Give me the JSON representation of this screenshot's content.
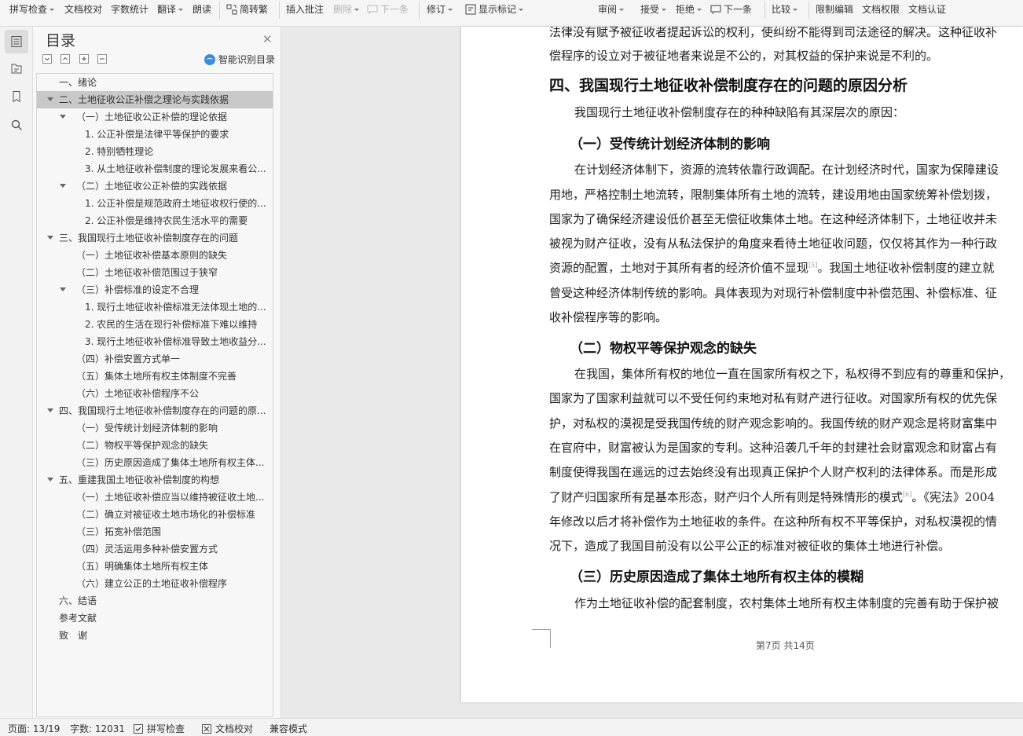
{
  "toolbar": {
    "spell_check": "拼写检查",
    "doc_proof": "文档校对",
    "word_count": "字数统计",
    "translate": "翻译",
    "read_aloud": "朗读",
    "simp_trad": "简转繁",
    "insert_comment": "插入批注",
    "delete": "删除",
    "next": "下一条",
    "track_changes": "修订",
    "show_markup": "显示标记",
    "review": "审阅",
    "accept": "接受",
    "reject": "拒绝",
    "next2": "下一条",
    "compare": "比较",
    "restrict_edit": "限制编辑",
    "doc_rights": "文档权限",
    "doc_cert": "文档认证"
  },
  "toc": {
    "title": "目录",
    "smart_label": "智能识别目录",
    "items": [
      {
        "text": "一、绪论",
        "level": 1,
        "expanded": null,
        "selected": false
      },
      {
        "text": "二、土地征收公正补偿之理论与实践依据",
        "level": 1,
        "expanded": true,
        "selected": true
      },
      {
        "text": "（一）土地征收公正补偿的理论依据",
        "level": 2,
        "expanded": true,
        "selected": false
      },
      {
        "text": "1. 公正补偿是法律平等保护的要求",
        "level": 3,
        "expanded": null,
        "selected": false
      },
      {
        "text": "2. 特别牺牲理论",
        "level": 3,
        "expanded": null,
        "selected": false
      },
      {
        "text": "3. 从土地征收补偿制度的理论发展来看公...",
        "level": 3,
        "expanded": null,
        "selected": false
      },
      {
        "text": "（二）土地征收公正补偿的实践依据",
        "level": 2,
        "expanded": true,
        "selected": false
      },
      {
        "text": "1. 公正补偿是规范政府土地征收权行使的...",
        "level": 3,
        "expanded": null,
        "selected": false
      },
      {
        "text": "2. 公正补偿是维持农民生活水平的需要",
        "level": 3,
        "expanded": null,
        "selected": false
      },
      {
        "text": "三、我国现行土地征收补偿制度存在的问题",
        "level": 1,
        "expanded": true,
        "selected": false
      },
      {
        "text": "（一）土地征收补偿基本原则的缺失",
        "level": 2,
        "expanded": null,
        "selected": false
      },
      {
        "text": "（二）土地征收补偿范围过于狭窄",
        "level": 2,
        "expanded": null,
        "selected": false
      },
      {
        "text": "（三）补偿标准的设定不合理",
        "level": 2,
        "expanded": true,
        "selected": false
      },
      {
        "text": "1. 现行土地征收补偿标准无法体现土地的...",
        "level": 3,
        "expanded": null,
        "selected": false
      },
      {
        "text": "2. 农民的生活在现行补偿标准下难以维持",
        "level": 3,
        "expanded": null,
        "selected": false
      },
      {
        "text": "3. 现行土地征收补偿标准导致土地收益分...",
        "level": 3,
        "expanded": null,
        "selected": false
      },
      {
        "text": "（四）补偿安置方式单一",
        "level": 2,
        "expanded": null,
        "selected": false
      },
      {
        "text": "（五）集体土地所有权主体制度不完善",
        "level": 2,
        "expanded": null,
        "selected": false
      },
      {
        "text": "（六）土地征收补偿程序不公",
        "level": 2,
        "expanded": null,
        "selected": false
      },
      {
        "text": "四、我国现行土地征收补偿制度存在的问题的原...",
        "level": 1,
        "expanded": true,
        "selected": false
      },
      {
        "text": "（一）受传统计划经济体制的影响",
        "level": 2,
        "expanded": null,
        "selected": false
      },
      {
        "text": "（二）物权平等保护观念的缺失",
        "level": 2,
        "expanded": null,
        "selected": false
      },
      {
        "text": "（三）历史原因造成了集体土地所有权主体...",
        "level": 2,
        "expanded": null,
        "selected": false
      },
      {
        "text": "五、重建我国土地征收补偿制度的构想",
        "level": 1,
        "expanded": true,
        "selected": false
      },
      {
        "text": "（一）土地征收补偿应当以维持被征收土地...",
        "level": 2,
        "expanded": null,
        "selected": false
      },
      {
        "text": "（二）确立对被征收土地市场化的补偿标准",
        "level": 2,
        "expanded": null,
        "selected": false
      },
      {
        "text": "（三）拓宽补偿范围",
        "level": 2,
        "expanded": null,
        "selected": false
      },
      {
        "text": "（四）灵活运用多种补偿安置方式",
        "level": 2,
        "expanded": null,
        "selected": false
      },
      {
        "text": "（五）明确集体土地所有权主体",
        "level": 2,
        "expanded": null,
        "selected": false
      },
      {
        "text": "（六）建立公正的土地征收补偿程序",
        "level": 2,
        "expanded": null,
        "selected": false
      },
      {
        "text": "六、结语",
        "level": 1,
        "expanded": null,
        "selected": false
      },
      {
        "text": "参考文献",
        "level": 1,
        "expanded": null,
        "selected": false
      },
      {
        "text": "致　谢",
        "level": 1,
        "expanded": null,
        "selected": false
      }
    ]
  },
  "document": {
    "lines": [
      {
        "text": "法律没有赋予被征收者提起诉讼的权利，使纠纷不能得到司法途径的解决。这种征收补",
        "style": "body"
      },
      {
        "text": "偿程序的设立对于被征地者来说是不公的，对其权益的保护来说是不利的。",
        "style": "body"
      },
      {
        "text": "四、我国现行土地征收补偿制度存在的问题的原因分析",
        "style": "h2"
      },
      {
        "text": "我国现行土地征收补偿制度存在的种种缺陷有其深层次的原因：",
        "style": "indent"
      },
      {
        "text": "（一）受传统计划经济体制的影响",
        "style": "h3"
      },
      {
        "text": "在计划经济体制下，资源的流转依靠行政调配。在计划经济时代，国家为保障建设",
        "style": "indent"
      },
      {
        "text": "用地，严格控制土地流转，限制集体所有土地的流转，建设用地由国家统筹补偿划拨，",
        "style": "body"
      },
      {
        "text": "国家为了确保经济建设低价甚至无偿征收集体土地。在这种经济体制下，土地征收并未",
        "style": "body"
      },
      {
        "text": "被视为财产征收，没有从私法保护的角度来看待土地征收问题，仅仅将其作为一种行政",
        "style": "body"
      },
      {
        "text": "资源的配置，土地对于其所有者的经济价值不显现",
        "sup": "[5]",
        "after": "。我国土地征收补偿制度的建立就",
        "style": "body"
      },
      {
        "text": "曾受这种经济体制传统的影响。具体表现为对现行补偿制度中补偿范围、补偿标准、征",
        "style": "body"
      },
      {
        "text": "收补偿程序等的影响。",
        "style": "body"
      },
      {
        "text": "（二）物权平等保护观念的缺失",
        "style": "h3"
      },
      {
        "text": "在我国，集体所有权的地位一直在国家所有权之下，私权得不到应有的尊重和保护，",
        "style": "indent"
      },
      {
        "text": "国家为了国家利益就可以不受任何约束地对私有财产进行征收。对国家所有权的优先保",
        "style": "body"
      },
      {
        "text": "护，对私权的漠视是受我国传统的财产观念影响的。我国传统的财产观念是将财富集中",
        "style": "body"
      },
      {
        "text": "在官府中，财富被认为是国家的专利。这种沿袭几千年的封建社会财富观念和财富占有",
        "style": "body"
      },
      {
        "text": "制度使得我国在遥远的过去始终没有出现真正保护个人财产权利的法律体系。而是形成",
        "style": "body"
      },
      {
        "text": "了财产归国家所有是基本形态，财产归个人所有则是特殊情形的模式",
        "sup": "[6]",
        "after": "。《宪法》2004",
        "style": "body"
      },
      {
        "text": "年修改以后才将补偿作为土地征收的条件。在这种所有权不平等保护，对私权漠视的情",
        "style": "body"
      },
      {
        "text": "况下，造成了我国目前没有以公平公正的标准对被征收的集体土地进行补偿。",
        "style": "body"
      },
      {
        "text": "（三）历史原因造成了集体土地所有权主体的模糊",
        "style": "h3"
      },
      {
        "text": "作为土地征收补偿的配套制度，农村集体土地所有权主体制度的完善有助于保护被",
        "style": "indent"
      }
    ],
    "page_indicator": "第7页 共14页"
  },
  "status": {
    "page": "页面: 13/19",
    "words": "字数: 12031",
    "spell_check": "拼写检查",
    "doc_proof": "文档校对",
    "compat_mode": "兼容模式"
  }
}
